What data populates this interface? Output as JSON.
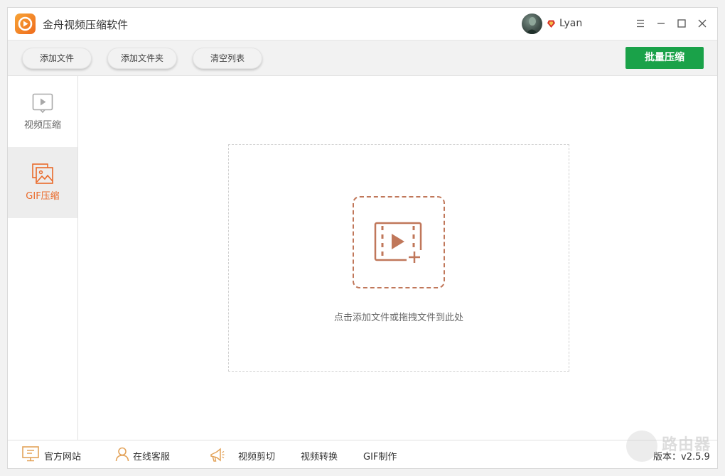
{
  "titlebar": {
    "app_title": "金舟视频压缩软件",
    "user_name": "Lyan"
  },
  "toolbar": {
    "add_file": "添加文件",
    "add_folder": "添加文件夹",
    "clear_list": "清空列表",
    "batch_compress": "批量压缩"
  },
  "sidebar": {
    "items": [
      {
        "label": "视频压缩",
        "icon": "video-play-icon"
      },
      {
        "label": "GIF压缩",
        "icon": "image-gallery-icon"
      }
    ]
  },
  "main": {
    "drop_hint": "点击添加文件或拖拽文件到此处"
  },
  "footer": {
    "official_site": "官方网站",
    "online_service": "在线客服",
    "video_cut": "视频剪切",
    "video_convert": "视频转换",
    "gif_make": "GIF制作",
    "version": "版本：v2.5.9",
    "watermark": "路由器"
  },
  "colors": {
    "accent_orange": "#ea6a2a",
    "primary_green": "#1aa249",
    "drop_icon": "#c0775a"
  }
}
